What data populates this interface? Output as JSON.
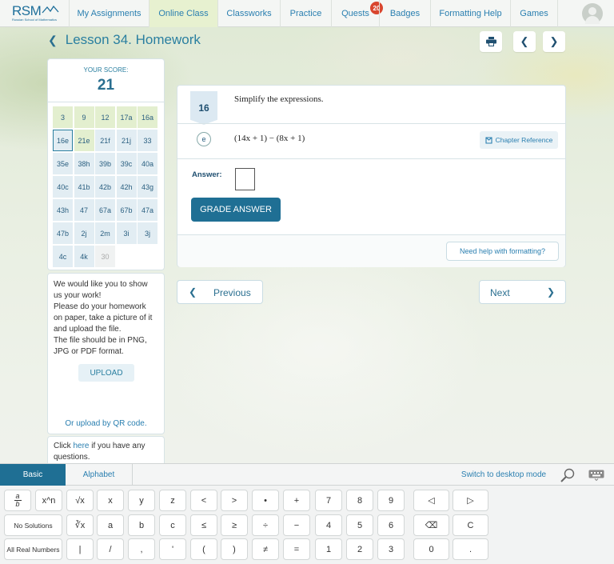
{
  "nav": {
    "logo_text": "RSM",
    "logo_sub": "Russian School of Mathematics",
    "items": [
      {
        "label": "My Assignments"
      },
      {
        "label": "Online Class"
      },
      {
        "label": "Classworks"
      },
      {
        "label": "Practice"
      },
      {
        "label": "Quests",
        "badge": "20"
      },
      {
        "label": "Badges"
      },
      {
        "label": "Formatting Help"
      },
      {
        "label": "Games"
      }
    ],
    "active_index": 1
  },
  "page": {
    "title": "Lesson 34. Homework"
  },
  "score": {
    "label": "YOUR SCORE:",
    "value": "21"
  },
  "problems": [
    [
      "3",
      "9",
      "12",
      "17a",
      "16a"
    ],
    [
      "16e",
      "21e",
      "21f",
      "21j",
      "33"
    ],
    [
      "35e",
      "38h",
      "39b",
      "39c",
      "40a"
    ],
    [
      "40c",
      "41b",
      "42b",
      "42h",
      "43g"
    ],
    [
      "43h",
      "47",
      "67a",
      "67b",
      "47a"
    ],
    [
      "47b",
      "2j",
      "2m",
      "3i",
      "3j"
    ],
    [
      "4c",
      "4k",
      "30"
    ]
  ],
  "problem_status": [
    [
      "g",
      "g",
      "g",
      "g",
      "g"
    ],
    [
      "sel",
      "g",
      "b",
      "b",
      "b"
    ],
    [
      "b",
      "b",
      "b",
      "b",
      "b"
    ],
    [
      "b",
      "b",
      "b",
      "b",
      "b"
    ],
    [
      "b",
      "b",
      "b",
      "b",
      "b"
    ],
    [
      "b",
      "b",
      "b",
      "b",
      "b"
    ],
    [
      "b",
      "b",
      "d"
    ]
  ],
  "work_panel": {
    "lines": [
      "We would like you to show",
      "us your work!",
      "Please do your homework",
      "on paper, take a picture of it",
      "and upload the file.",
      "The file should be in PNG,",
      "JPG or PDF format."
    ],
    "upload_label": "UPLOAD",
    "qr_link": "Or upload by QR code."
  },
  "questions_panel": {
    "prefix": "Click ",
    "link": "here",
    "suffix_1": " if you have any",
    "suffix_2": "questions."
  },
  "question": {
    "number": "16",
    "instruction": "Simplify the expressions.",
    "part_letter": "e",
    "expression": "(14x + 1) − (8x + 1)",
    "chapter_ref": "Chapter Reference",
    "answer_label": "Answer:",
    "grade_label": "GRADE ANSWER",
    "help_label": "Need help with formatting?",
    "prev_label": "Previous",
    "next_label": "Next"
  },
  "keyboard": {
    "tabs": [
      "Basic",
      "Alphabet"
    ],
    "active_tab": 0,
    "switch_label": "Switch to desktop mode",
    "keys_row1": [
      "a/b",
      "x^n",
      "√x",
      "x",
      "y",
      "z",
      "<",
      ">",
      "•",
      "+",
      "7",
      "8",
      "9",
      "◁",
      "▷"
    ],
    "keys_row2": [
      "No Solutions",
      "∛x",
      "a",
      "b",
      "c",
      "≤",
      "≥",
      "÷",
      "−",
      "4",
      "5",
      "6",
      "⌫",
      "C"
    ],
    "keys_row3": [
      "All Real Numbers",
      "|",
      "/",
      ",",
      "'",
      "(",
      ")",
      "≠",
      "=",
      "1",
      "2",
      "3",
      "0",
      "."
    ]
  },
  "colors": {
    "accent": "#1f6f94",
    "link": "#2a7fb0",
    "nav_active": "#e7f1d0",
    "cell_green": "#e3efcf",
    "cell_blue": "#e2edf3",
    "badge": "#d9462e"
  }
}
